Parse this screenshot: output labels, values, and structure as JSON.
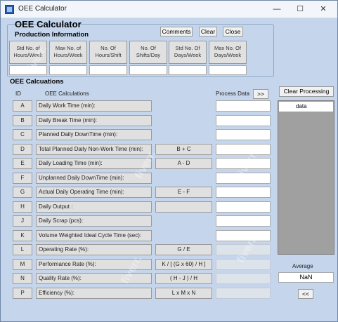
{
  "window": {
    "title": "OEE Calculator",
    "minimize": "—",
    "maximize": "☐",
    "close": "✕"
  },
  "headings": {
    "main": "OEE Calculator",
    "production": "Production Information",
    "calculations": "OEE Calcuations"
  },
  "buttons": {
    "comments": "Comments",
    "clear": "Clear",
    "close": "Close",
    "expand": ">>",
    "collapse": "<<",
    "clear_processing": "Clear Processing"
  },
  "production_fields": [
    {
      "label": "Std No. of Hours/Week",
      "value": ""
    },
    {
      "label": "Max No. of Hours/Week",
      "value": ""
    },
    {
      "label": "No. Of Hours/Shift",
      "value": ""
    },
    {
      "label": "No. Of Shifts/Day",
      "value": ""
    },
    {
      "label": "Std No. Of Days/Week",
      "value": ""
    },
    {
      "label": "Max No. Of Days/Week",
      "value": ""
    }
  ],
  "columns": {
    "id": "ID",
    "calc": "OEE Calculations",
    "process": "Process Data"
  },
  "rows": [
    {
      "id": "A",
      "desc": "Daily Work Time (min):",
      "formula": null,
      "disabled": false
    },
    {
      "id": "B",
      "desc": "Daily Break Time (min):",
      "formula": null,
      "disabled": false
    },
    {
      "id": "C",
      "desc": "Planned Daily DownTime (min):",
      "formula": null,
      "disabled": false
    },
    {
      "id": "D",
      "desc": "Total Planned Daily Non-Work Time (min):",
      "formula": "B + C",
      "disabled": false
    },
    {
      "id": "E",
      "desc": "Daily Loading Time (min):",
      "formula": "A - D",
      "disabled": false
    },
    {
      "id": "F",
      "desc": "Unplanned Daily DownTime (min):",
      "formula": null,
      "disabled": false
    },
    {
      "id": "G",
      "desc": "Actual Daily Operating Time (min):",
      "formula": "E - F",
      "disabled": false
    },
    {
      "id": "H",
      "desc": "Daily Output :",
      "formula": "",
      "disabled": false
    },
    {
      "id": "J",
      "desc": "Daily Scrap (pcs):",
      "formula": null,
      "disabled": false
    },
    {
      "id": "K",
      "desc": "Volume Weighted Ideal Cycle Time (sec):",
      "formula": null,
      "disabled": false
    },
    {
      "id": "L",
      "desc": "Operating Rate (%):",
      "formula": "G / E",
      "disabled": true
    },
    {
      "id": "M",
      "desc": "Performance Rate (%):",
      "formula": "K / [ (G x 60) / H ]",
      "disabled": true
    },
    {
      "id": "N",
      "desc": "Quality Rate (%):",
      "formula": "( H - J ) / H",
      "disabled": true
    },
    {
      "id": "P",
      "desc": "Efficiency (%):",
      "formula": "L x M x N",
      "disabled": true
    }
  ],
  "listbox": {
    "items": [
      "data"
    ]
  },
  "average": {
    "label": "Average",
    "value": "NaN"
  },
  "watermark": "fiverr."
}
